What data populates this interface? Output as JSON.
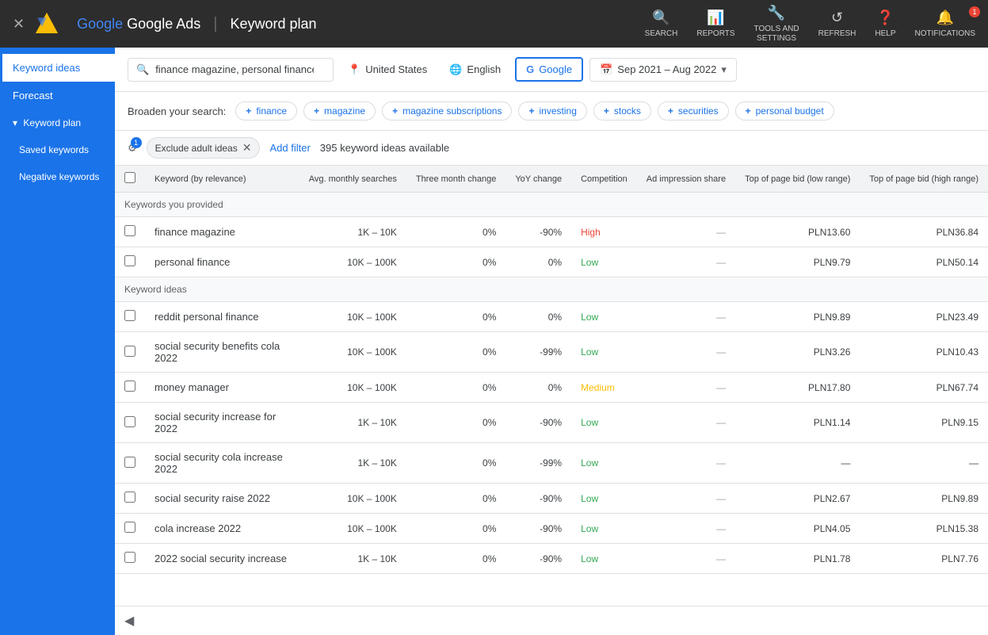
{
  "topNav": {
    "brand": "Google Ads",
    "title": "Keyword plan",
    "actions": [
      {
        "id": "search",
        "icon": "🔍",
        "label": "SEARCH"
      },
      {
        "id": "reports",
        "icon": "📊",
        "label": "REPORTS"
      },
      {
        "id": "tools",
        "icon": "🔧",
        "label": "TOOLS AND\nSETTINGS"
      },
      {
        "id": "refresh",
        "icon": "↺",
        "label": "REFRESH"
      },
      {
        "id": "help",
        "icon": "?",
        "label": "HELP"
      },
      {
        "id": "notifications",
        "icon": "🔔",
        "label": "NOTIFICATIONS",
        "badge": "1"
      }
    ]
  },
  "sidebar": {
    "items": [
      {
        "id": "keyword-ideas",
        "label": "Keyword ideas",
        "active": true
      },
      {
        "id": "forecast",
        "label": "Forecast"
      },
      {
        "id": "keyword-plan",
        "label": "Keyword plan",
        "parent": true
      },
      {
        "id": "saved-keywords",
        "label": "Saved keywords",
        "sub": true
      },
      {
        "id": "negative-keywords",
        "label": "Negative keywords",
        "sub": true
      }
    ]
  },
  "filterBar": {
    "searchValue": "finance magazine, personal finance",
    "searchPlaceholder": "finance magazine, personal finance",
    "location": "United States",
    "language": "English",
    "searchEngine": "Google",
    "dateRange": "Sep 2021 – Aug 2022"
  },
  "broadenSearch": {
    "label": "Broaden your search:",
    "chips": [
      {
        "id": "finance",
        "label": "finance"
      },
      {
        "id": "magazine",
        "label": "magazine"
      },
      {
        "id": "magazine-subscriptions",
        "label": "magazine subscriptions"
      },
      {
        "id": "investing",
        "label": "investing"
      },
      {
        "id": "stocks",
        "label": "stocks"
      },
      {
        "id": "securities",
        "label": "securities"
      },
      {
        "id": "personal-budget",
        "label": "personal budget"
      }
    ]
  },
  "actionsBar": {
    "filterBadge": "1",
    "excludeChip": "Exclude adult ideas",
    "addFilter": "Add filter",
    "keywordCount": "395 keyword ideas available"
  },
  "table": {
    "columns": [
      {
        "id": "checkbox",
        "label": ""
      },
      {
        "id": "keyword",
        "label": "Keyword (by relevance)"
      },
      {
        "id": "avg-monthly",
        "label": "Avg. monthly searches",
        "numeric": true
      },
      {
        "id": "three-month",
        "label": "Three month change",
        "numeric": true
      },
      {
        "id": "yoy",
        "label": "YoY change",
        "numeric": true
      },
      {
        "id": "competition",
        "label": "Competition"
      },
      {
        "id": "ad-impression",
        "label": "Ad impression share",
        "numeric": true
      },
      {
        "id": "top-bid-low",
        "label": "Top of page bid (low range)",
        "numeric": true
      },
      {
        "id": "top-bid-high",
        "label": "Top of page bid (high range)",
        "numeric": true
      }
    ],
    "sections": [
      {
        "id": "provided",
        "label": "Keywords you provided",
        "rows": [
          {
            "keyword": "finance magazine",
            "avgMonthly": "1K – 10K",
            "threeMonth": "0%",
            "yoy": "-90%",
            "competition": "High",
            "competitionClass": "high",
            "adImpression": "—",
            "topBidLow": "PLN13.60",
            "topBidHigh": "PLN36.84"
          },
          {
            "keyword": "personal finance",
            "avgMonthly": "10K – 100K",
            "threeMonth": "0%",
            "yoy": "0%",
            "competition": "Low",
            "competitionClass": "low",
            "adImpression": "—",
            "topBidLow": "PLN9.79",
            "topBidHigh": "PLN50.14"
          }
        ]
      },
      {
        "id": "ideas",
        "label": "Keyword ideas",
        "rows": [
          {
            "keyword": "reddit personal finance",
            "avgMonthly": "10K – 100K",
            "threeMonth": "0%",
            "yoy": "0%",
            "competition": "Low",
            "competitionClass": "low",
            "adImpression": "—",
            "topBidLow": "PLN9.89",
            "topBidHigh": "PLN23.49"
          },
          {
            "keyword": "social security benefits cola 2022",
            "avgMonthly": "10K – 100K",
            "threeMonth": "0%",
            "yoy": "-99%",
            "competition": "Low",
            "competitionClass": "low",
            "adImpression": "—",
            "topBidLow": "PLN3.26",
            "topBidHigh": "PLN10.43"
          },
          {
            "keyword": "money manager",
            "avgMonthly": "10K – 100K",
            "threeMonth": "0%",
            "yoy": "0%",
            "competition": "Medium",
            "competitionClass": "medium",
            "adImpression": "—",
            "topBidLow": "PLN17.80",
            "topBidHigh": "PLN67.74"
          },
          {
            "keyword": "social security increase for 2022",
            "avgMonthly": "1K – 10K",
            "threeMonth": "0%",
            "yoy": "-90%",
            "competition": "Low",
            "competitionClass": "low",
            "adImpression": "—",
            "topBidLow": "PLN1.14",
            "topBidHigh": "PLN9.15"
          },
          {
            "keyword": "social security cola increase 2022",
            "avgMonthly": "1K – 10K",
            "threeMonth": "0%",
            "yoy": "-99%",
            "competition": "Low",
            "competitionClass": "low",
            "adImpression": "—",
            "topBidLow": "—",
            "topBidHigh": "—"
          },
          {
            "keyword": "social security raise 2022",
            "avgMonthly": "10K – 100K",
            "threeMonth": "0%",
            "yoy": "-90%",
            "competition": "Low",
            "competitionClass": "low",
            "adImpression": "—",
            "topBidLow": "PLN2.67",
            "topBidHigh": "PLN9.89"
          },
          {
            "keyword": "cola increase 2022",
            "avgMonthly": "10K – 100K",
            "threeMonth": "0%",
            "yoy": "-90%",
            "competition": "Low",
            "competitionClass": "low",
            "adImpression": "—",
            "topBidLow": "PLN4.05",
            "topBidHigh": "PLN15.38"
          },
          {
            "keyword": "2022 social security increase",
            "avgMonthly": "1K – 10K",
            "threeMonth": "0%",
            "yoy": "-90%",
            "competition": "Low",
            "competitionClass": "low",
            "adImpression": "—",
            "topBidLow": "PLN1.78",
            "topBidHigh": "PLN7.76"
          }
        ]
      }
    ]
  }
}
